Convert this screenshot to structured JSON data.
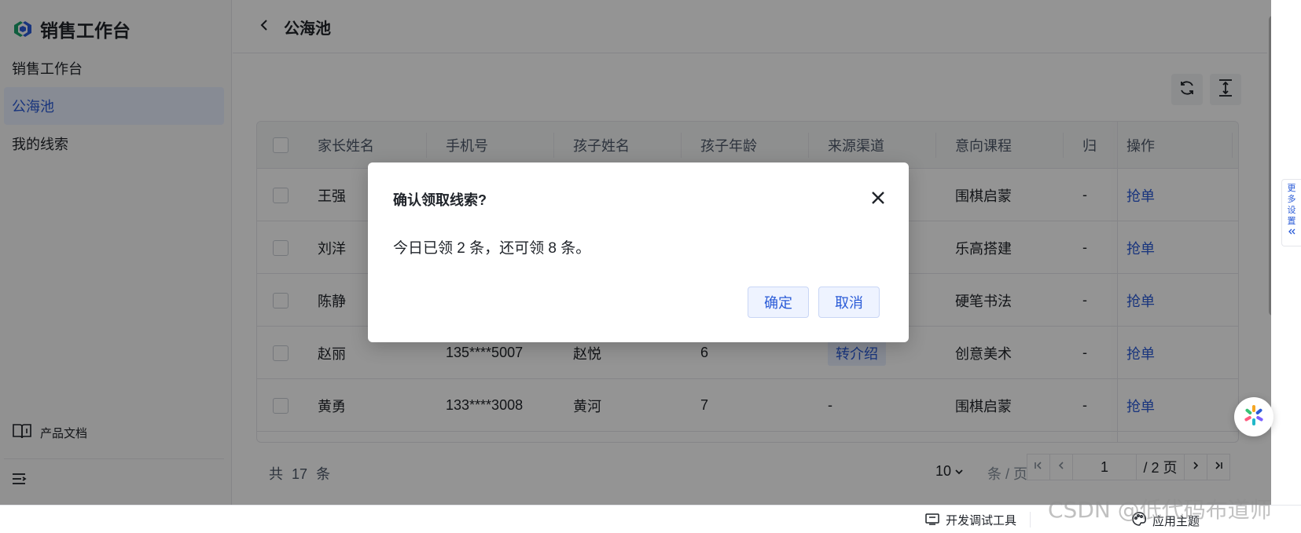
{
  "sidebar": {
    "app_title": "销售工作台",
    "items": [
      {
        "label": "销售工作台",
        "active": false
      },
      {
        "label": "公海池",
        "active": true
      },
      {
        "label": "我的线索",
        "active": false
      }
    ],
    "doc_link": "产品文档"
  },
  "header": {
    "title": "公海池"
  },
  "table": {
    "columns": [
      "家长姓名",
      "手机号",
      "孩子姓名",
      "孩子年龄",
      "来源渠道",
      "意向课程",
      "归",
      "操作"
    ],
    "rows": [
      {
        "parent": "王强",
        "phone": "",
        "child": "",
        "age": "",
        "source": "",
        "course": "围棋启蒙",
        "owner": "-",
        "action": "抢单"
      },
      {
        "parent": "刘洋",
        "phone": "",
        "child": "",
        "age": "",
        "source": "",
        "course": "乐高搭建",
        "owner": "-",
        "action": "抢单"
      },
      {
        "parent": "陈静",
        "phone": "",
        "child": "",
        "age": "",
        "source": "",
        "course": "硬笔书法",
        "owner": "-",
        "action": "抢单"
      },
      {
        "parent": "赵丽",
        "phone": "135****5007",
        "child": "赵悦",
        "age": "6",
        "source": "转介绍",
        "course": "创意美术",
        "owner": "-",
        "action": "抢单"
      },
      {
        "parent": "黄勇",
        "phone": "133****3008",
        "child": "黄河",
        "age": "7",
        "source": "-",
        "course": "围棋启蒙",
        "owner": "-",
        "action": "抢单"
      }
    ]
  },
  "pagination": {
    "total_prefix": "共",
    "total": "17",
    "total_suffix": "条",
    "page_size": "10",
    "page_size_unit": "条 / 页",
    "current_page": "1",
    "total_pages": "/ 2 页"
  },
  "side_panel": {
    "more_settings": "更多设置"
  },
  "modal": {
    "title": "确认领取线索?",
    "body": "今日已领 2 条，还可领 8 条。",
    "confirm_label": "确定",
    "cancel_label": "取消"
  },
  "bottom_bar": {
    "dev_tools": "开发调试工具",
    "theme": "应用主题",
    "watermark": "CSDN @低代码布道师"
  },
  "colors": {
    "accent": "#2a5bd7",
    "accent_bg": "#e8efff",
    "mask": "rgba(0,0,0,0.42)",
    "logo_green": "#1aa36b",
    "logo_blue": "#2a5bd7"
  },
  "icons": [
    "logo-icon",
    "chevron-left-icon",
    "refresh-icon",
    "column-height-icon",
    "book-icon",
    "menu-collapse-icon",
    "close-icon",
    "first-page-icon",
    "prev-page-icon",
    "next-page-icon",
    "last-page-icon",
    "chevron-down-icon",
    "dev-tools-icon",
    "palette-icon",
    "assistant-icon",
    "double-chevron-left-icon"
  ]
}
